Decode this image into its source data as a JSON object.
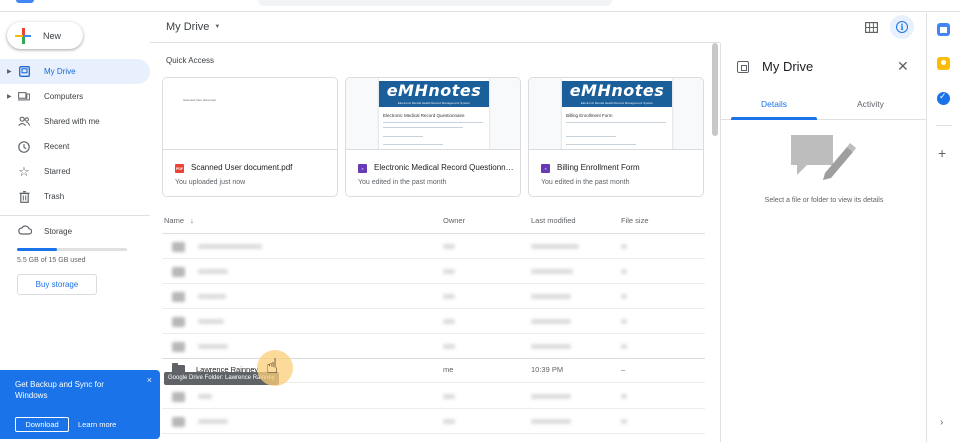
{
  "sidebar": {
    "new_label": "New",
    "items": [
      {
        "label": "My Drive",
        "active": true
      },
      {
        "label": "Computers"
      },
      {
        "label": "Shared with me"
      },
      {
        "label": "Recent"
      },
      {
        "label": "Starred"
      },
      {
        "label": "Trash"
      }
    ],
    "storage": {
      "label": "Storage",
      "used_text": "5.5 GB of 15 GB used",
      "used_fraction": 0.367,
      "buy_label": "Buy storage"
    }
  },
  "promo": {
    "title": "Get Backup and Sync for Windows",
    "close": "×",
    "download": "Download",
    "learn_more": "Learn more"
  },
  "main": {
    "title": "My Drive",
    "quick_access_label": "Quick Access",
    "cards": [
      {
        "name": "Scanned User document.pdf",
        "sub": "You uploaded just now",
        "type_badge": "PDF",
        "thumb_text": "Scanned User document"
      },
      {
        "name": "Electronic Medical Record Questionnaire",
        "sub": "You edited in the past month",
        "brand": "eMHnotes",
        "brand_sub": "Electronic Mental Health Record Management System",
        "form_title": "Electronic Medical Record Questionnaire"
      },
      {
        "name": "Billing Enrollment Form",
        "sub": "You edited in the past month",
        "brand": "eMHnotes",
        "brand_sub": "Electronic Mental Health Record Management System",
        "form_title": "Billing Enrollment Form"
      }
    ],
    "columns": {
      "name": "Name",
      "sort_icon": "↓",
      "owner": "Owner",
      "modified": "Last modified",
      "size": "File size"
    },
    "visible_row": {
      "name": "Lawrence Rainney",
      "owner": "me",
      "modified": "10:39 PM",
      "size": "–"
    },
    "tooltip": "Google Drive Folder: Lawrence Rainney"
  },
  "details": {
    "title": "My Drive",
    "close": "✕",
    "tabs": [
      "Details",
      "Activity"
    ],
    "empty_text": "Select a file or folder to view its details"
  },
  "colors": {
    "accent": "#1a73e8",
    "active_bg": "#e8f0fe",
    "promo_bg": "#1a73e8"
  }
}
